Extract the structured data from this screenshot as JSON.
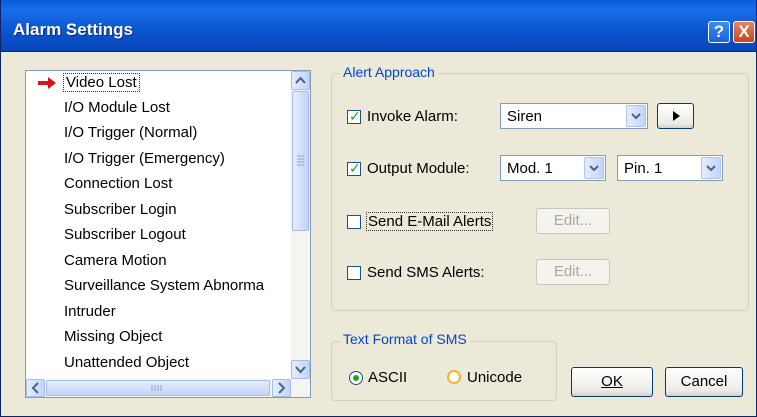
{
  "window": {
    "title": "Alarm Settings",
    "help_label": "?",
    "close_label": "X"
  },
  "events_list": {
    "selected_index": 0,
    "items": [
      "Video Lost",
      "I/O Module Lost",
      "I/O Trigger (Normal)",
      "I/O Trigger (Emergency)",
      "Connection Lost",
      "Subscriber Login",
      "Subscriber Logout",
      "Camera Motion",
      "Surveillance System Abnorma",
      "Intruder",
      "Missing Object",
      "Unattended Object"
    ]
  },
  "alert_approach": {
    "legend": "Alert Approach",
    "invoke_alarm": {
      "label": "Invoke Alarm:",
      "checked": true,
      "value": "Siren"
    },
    "output_module": {
      "label": "Output Module:",
      "checked": true,
      "module_value": "Mod. 1",
      "pin_value": "Pin. 1"
    },
    "email_alerts": {
      "label": "Send E-Mail Alerts",
      "checked": false,
      "edit_label": "Edit..."
    },
    "sms_alerts": {
      "label": "Send SMS Alerts:",
      "checked": false,
      "edit_label": "Edit..."
    }
  },
  "sms_format": {
    "legend": "Text Format of SMS",
    "ascii_label": "ASCII",
    "unicode_label": "Unicode",
    "selected": "ASCII"
  },
  "buttons": {
    "ok_label": "OK",
    "cancel_label": "Cancel"
  },
  "colors": {
    "title_bar": "#0a55d0",
    "legend_text": "#0046d5",
    "check_green": "#21a121",
    "selection_arrow": "#d01818"
  }
}
